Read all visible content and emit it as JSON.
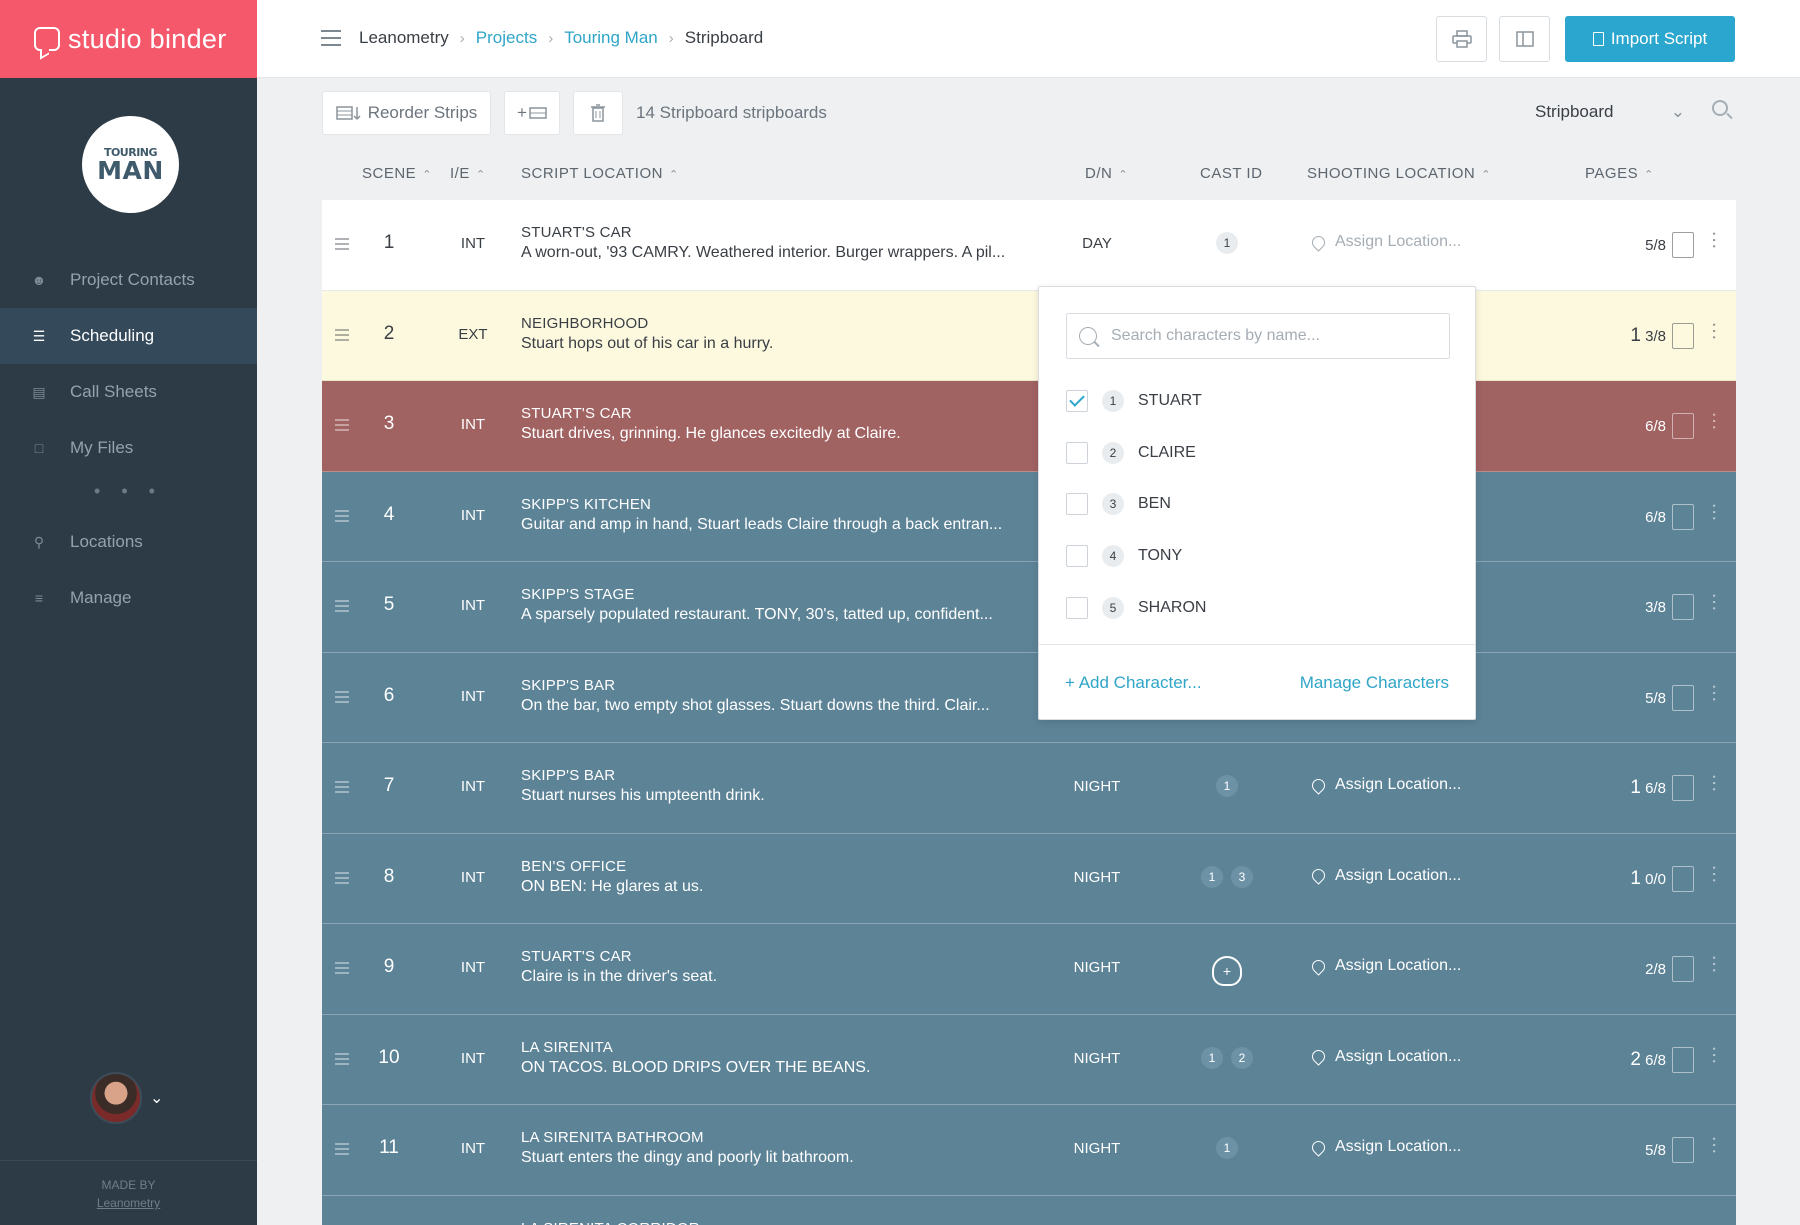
{
  "brand": {
    "name": "studio binder"
  },
  "project_logo": {
    "line1": "TOURING",
    "line2": "MAN"
  },
  "sidebar": {
    "items": [
      {
        "label": "Project Contacts",
        "icon": "contacts-icon",
        "active": false
      },
      {
        "label": "Scheduling",
        "icon": "schedule-icon",
        "active": true
      },
      {
        "label": "Call Sheets",
        "icon": "calendar-icon",
        "active": false
      },
      {
        "label": "My Files",
        "icon": "folder-icon",
        "active": false
      }
    ],
    "more": "• • •",
    "items2": [
      {
        "label": "Locations",
        "icon": "pin-icon"
      },
      {
        "label": "Manage",
        "icon": "sliders-icon"
      }
    ],
    "made_by": "MADE BY",
    "made_by_link": "Leanometry"
  },
  "breadcrumb": {
    "root": "Leanometry",
    "projects": "Projects",
    "project": "Touring Man",
    "current": "Stripboard"
  },
  "header": {
    "import_label": "Import Script"
  },
  "toolbar": {
    "reorder_label": "Reorder Strips",
    "add_label": "+",
    "count_text": "14 Stripboard stripboards",
    "view_selected": "Stripboard"
  },
  "columns": {
    "scene": "SCENE",
    "ie": "I/E",
    "location": "SCRIPT LOCATION",
    "dn": "D/N",
    "cast": "CAST ID",
    "shooting": "SHOOTING LOCATION",
    "pages": "PAGES"
  },
  "rows": [
    {
      "scene": "1",
      "ie": "INT",
      "location": "STUART'S CAR",
      "desc": "A worn-out, '93 CAMRY. Weathered interior. Burger wrappers. A pil...",
      "dn": "DAY",
      "cast": [
        "1"
      ],
      "assign": "Assign Location...",
      "pages_whole": "",
      "pages_frac": "5/8",
      "color": "white"
    },
    {
      "scene": "2",
      "ie": "EXT",
      "location": "NEIGHBORHOOD",
      "desc": "Stuart hops out of his car in a hurry.",
      "dn": "",
      "cast": [],
      "assign": "",
      "pages_whole": "1",
      "pages_frac": "3/8",
      "color": "yellow"
    },
    {
      "scene": "3",
      "ie": "INT",
      "location": "STUART'S CAR",
      "desc": "Stuart drives, grinning. He glances excitedly at Claire.",
      "dn": "",
      "cast": [],
      "assign": "",
      "pages_whole": "",
      "pages_frac": "6/8",
      "color": "red"
    },
    {
      "scene": "4",
      "ie": "INT",
      "location": "SKIPP'S KITCHEN",
      "desc": "Guitar and amp in hand, Stuart leads Claire through a back entran...",
      "dn": "",
      "cast": [],
      "assign": "",
      "pages_whole": "",
      "pages_frac": "6/8",
      "color": "blue"
    },
    {
      "scene": "5",
      "ie": "INT",
      "location": "SKIPP'S STAGE",
      "desc": "A sparsely populated restaurant. TONY, 30's, tatted up, confident...",
      "dn": "",
      "cast": [],
      "assign": "",
      "pages_whole": "",
      "pages_frac": "3/8",
      "color": "blue"
    },
    {
      "scene": "6",
      "ie": "INT",
      "location": "SKIPP'S BAR",
      "desc": "On the bar, two empty shot glasses. Stuart downs the third. Clair...",
      "dn": "",
      "cast": [],
      "assign": "",
      "pages_whole": "",
      "pages_frac": "5/8",
      "color": "blue"
    },
    {
      "scene": "7",
      "ie": "INT",
      "location": "SKIPP'S BAR",
      "desc": "Stuart nurses his umpteenth drink.",
      "dn": "NIGHT",
      "cast": [
        "1"
      ],
      "assign": "Assign Location...",
      "pages_whole": "1",
      "pages_frac": "6/8",
      "color": "blue"
    },
    {
      "scene": "8",
      "ie": "INT",
      "location": "BEN'S OFFICE",
      "desc": "ON BEN: He glares at us.",
      "dn": "NIGHT",
      "cast": [
        "1",
        "3"
      ],
      "assign": "Assign Location...",
      "pages_whole": "1",
      "pages_frac": "0/0",
      "color": "blue"
    },
    {
      "scene": "9",
      "ie": "INT",
      "location": "STUART'S CAR",
      "desc": "Claire is in the driver's seat.",
      "dn": "NIGHT",
      "cast": [],
      "add_cast": true,
      "assign": "Assign Location...",
      "pages_whole": "",
      "pages_frac": "2/8",
      "color": "blue"
    },
    {
      "scene": "10",
      "ie": "INT",
      "location": "LA SIRENITA",
      "desc": "ON TACOS. BLOOD DRIPS OVER THE BEANS.",
      "dn": "NIGHT",
      "cast": [
        "1",
        "2"
      ],
      "assign": "Assign Location...",
      "pages_whole": "2",
      "pages_frac": "6/8",
      "color": "blue"
    },
    {
      "scene": "11",
      "ie": "INT",
      "location": "LA SIRENITA BATHROOM",
      "desc": "Stuart enters the dingy and poorly lit bathroom.",
      "dn": "NIGHT",
      "cast": [
        "1"
      ],
      "assign": "Assign Location...",
      "pages_whole": "",
      "pages_frac": "5/8",
      "color": "blue"
    },
    {
      "scene": "",
      "ie": "",
      "location": "LA SIRENITA CORRIDOR",
      "desc": "",
      "dn": "",
      "cast": [],
      "add_cast": true,
      "assign": "",
      "pages_whole": "",
      "pages_frac": "",
      "color": "blue"
    }
  ],
  "cast_dropdown": {
    "placeholder": "Search characters by name...",
    "characters": [
      {
        "id": "1",
        "name": "STUART",
        "checked": true
      },
      {
        "id": "2",
        "name": "CLAIRE",
        "checked": false
      },
      {
        "id": "3",
        "name": "BEN",
        "checked": false
      },
      {
        "id": "4",
        "name": "TONY",
        "checked": false
      },
      {
        "id": "5",
        "name": "SHARON",
        "checked": false
      }
    ],
    "add_label": "+ Add Character...",
    "manage_label": "Manage Characters"
  },
  "colors": {
    "accent": "#2aa6cf",
    "brand": "#f4586a",
    "sidebar": "#2d3b47",
    "strip_red": "#a16262",
    "strip_blue": "#5d8397",
    "strip_yellow": "#fdf9df"
  }
}
